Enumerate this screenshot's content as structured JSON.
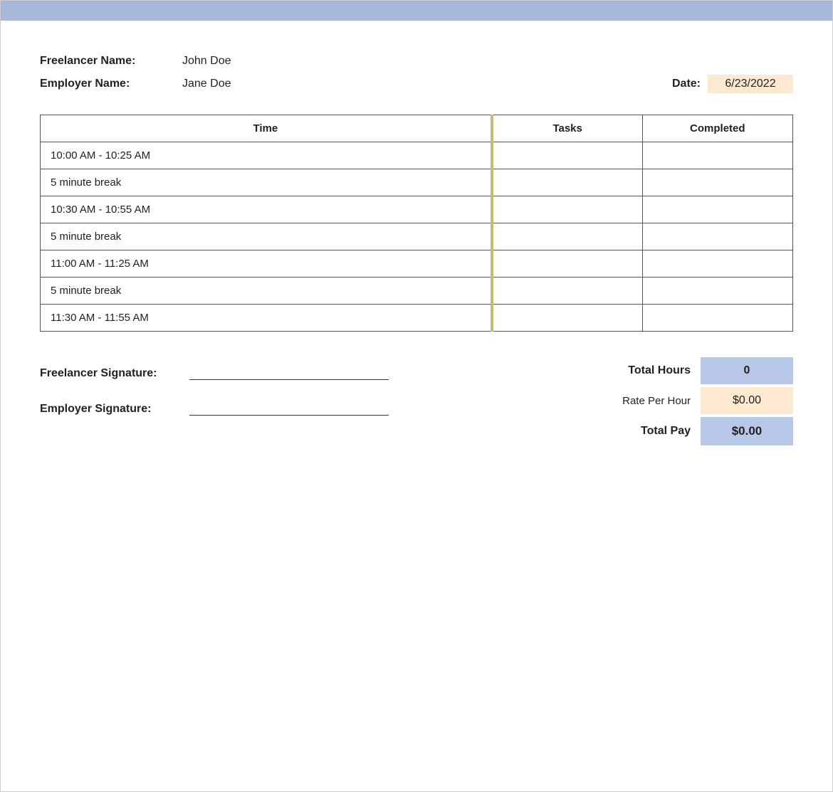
{
  "header": {
    "bar_color": "#a8b8d8"
  },
  "meta": {
    "freelancer_label": "Freelancer Name:",
    "freelancer_value": "John Doe",
    "employer_label": "Employer Name:",
    "employer_value": "Jane Doe",
    "date_label": "Date:",
    "date_value": "6/23/2022"
  },
  "table": {
    "headers": {
      "time": "Time",
      "tasks": "Tasks",
      "completed": "Completed"
    },
    "rows": [
      {
        "time": "10:00 AM - 10:25 AM",
        "tasks": "",
        "completed": ""
      },
      {
        "time": "5 minute break",
        "tasks": "",
        "completed": ""
      },
      {
        "time": "10:30 AM - 10:55 AM",
        "tasks": "",
        "completed": ""
      },
      {
        "time": "5 minute break",
        "tasks": "",
        "completed": ""
      },
      {
        "time": "11:00 AM - 11:25 AM",
        "tasks": "",
        "completed": ""
      },
      {
        "time": "5 minute break",
        "tasks": "",
        "completed": ""
      },
      {
        "time": "11:30 AM - 11:55 AM",
        "tasks": "",
        "completed": ""
      }
    ]
  },
  "summary": {
    "total_hours_label": "Total Hours",
    "total_hours_value": "0",
    "rate_label": "Rate Per Hour",
    "rate_value": "$0.00",
    "total_pay_label": "Total Pay",
    "total_pay_value": "$0.00",
    "freelancer_sig_label": "Freelancer Signature:",
    "employer_sig_label": "Employer Signature:"
  }
}
